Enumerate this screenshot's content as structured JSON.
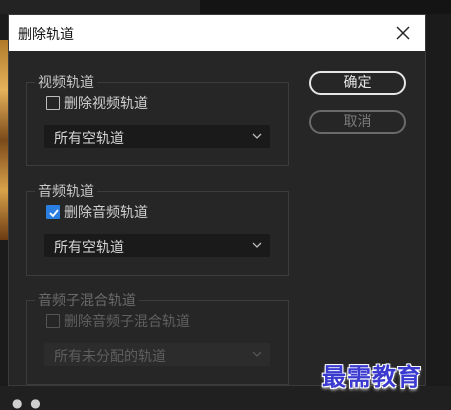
{
  "dialog": {
    "title": "删除轨道",
    "close_icon": "close-icon"
  },
  "video_group": {
    "label": "视频轨道",
    "checkbox_label": "删除视频轨道",
    "checked": false,
    "select_value": "所有空轨道"
  },
  "audio_group": {
    "label": "音频轨道",
    "checkbox_label": "删除音频轨道",
    "checked": true,
    "select_value": "所有空轨道"
  },
  "submix_group": {
    "label": "音频子混合轨道",
    "checkbox_label": "删除音频子混合轨道",
    "checked": false,
    "disabled": true,
    "select_value": "所有未分配的轨道"
  },
  "buttons": {
    "ok_label": "确定",
    "cancel_label": "取消"
  },
  "watermark": "最需教育",
  "colors": {
    "dialog_bg": "#262626",
    "accent": "#2a7de1",
    "title_bar": "#ffffff"
  }
}
